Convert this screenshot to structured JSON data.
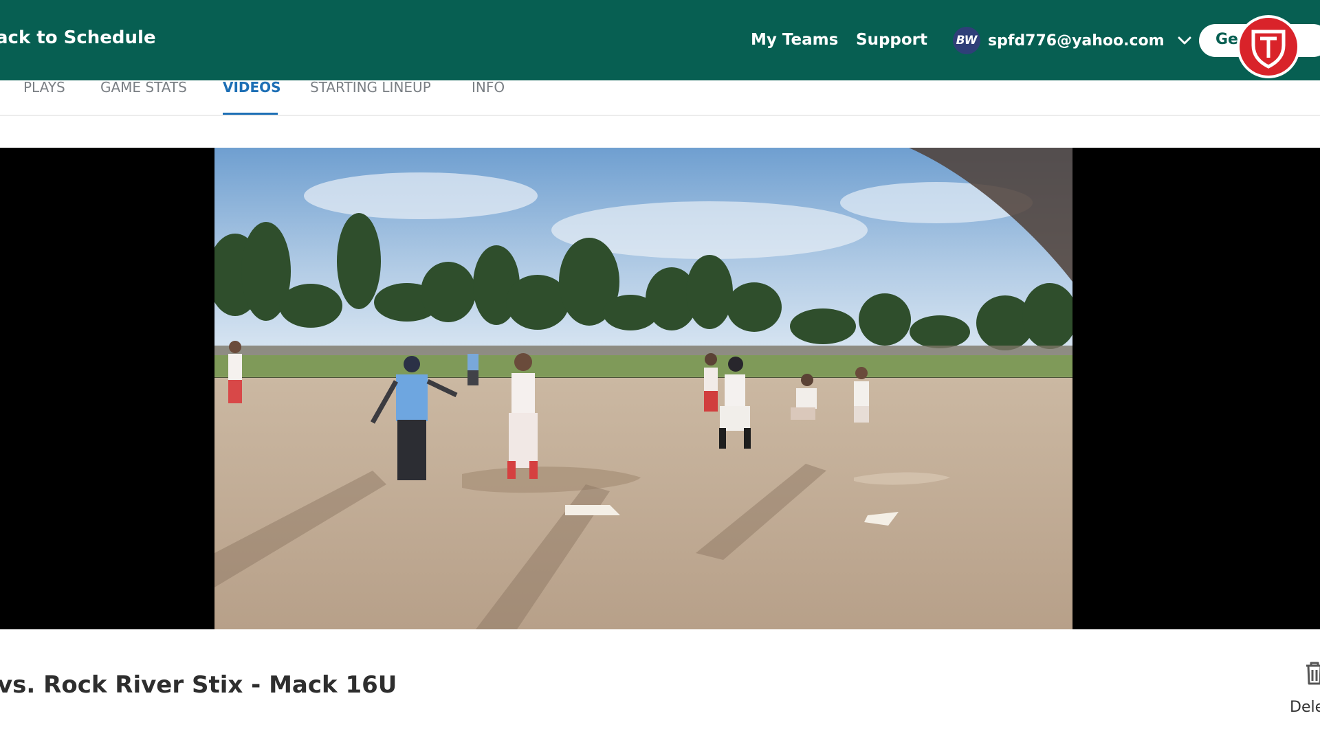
{
  "header": {
    "back_label": "ack to Schedule",
    "nav": {
      "my_teams": "My Teams",
      "support": "Support"
    },
    "user": {
      "initials": "BW",
      "email": "spfd776@yahoo.com"
    },
    "get_button_label": "Ge"
  },
  "tabs": [
    {
      "label": "PLAYS",
      "active": false
    },
    {
      "label": "GAME STATS",
      "active": false
    },
    {
      "label": "VIDEOS",
      "active": true
    },
    {
      "label": "STARTING LINEUP",
      "active": false
    },
    {
      "label": "INFO",
      "active": false
    }
  ],
  "video": {
    "title": "vs. Rock River Stix - Mack 16U"
  },
  "actions": {
    "delete_label": "Dele"
  },
  "colors": {
    "header_bg": "#075f52",
    "active_tab": "#1d6fb5",
    "badge_red": "#d9232a"
  },
  "icons": [
    "chevron-down-icon",
    "shield-logo-icon",
    "trash-icon"
  ]
}
